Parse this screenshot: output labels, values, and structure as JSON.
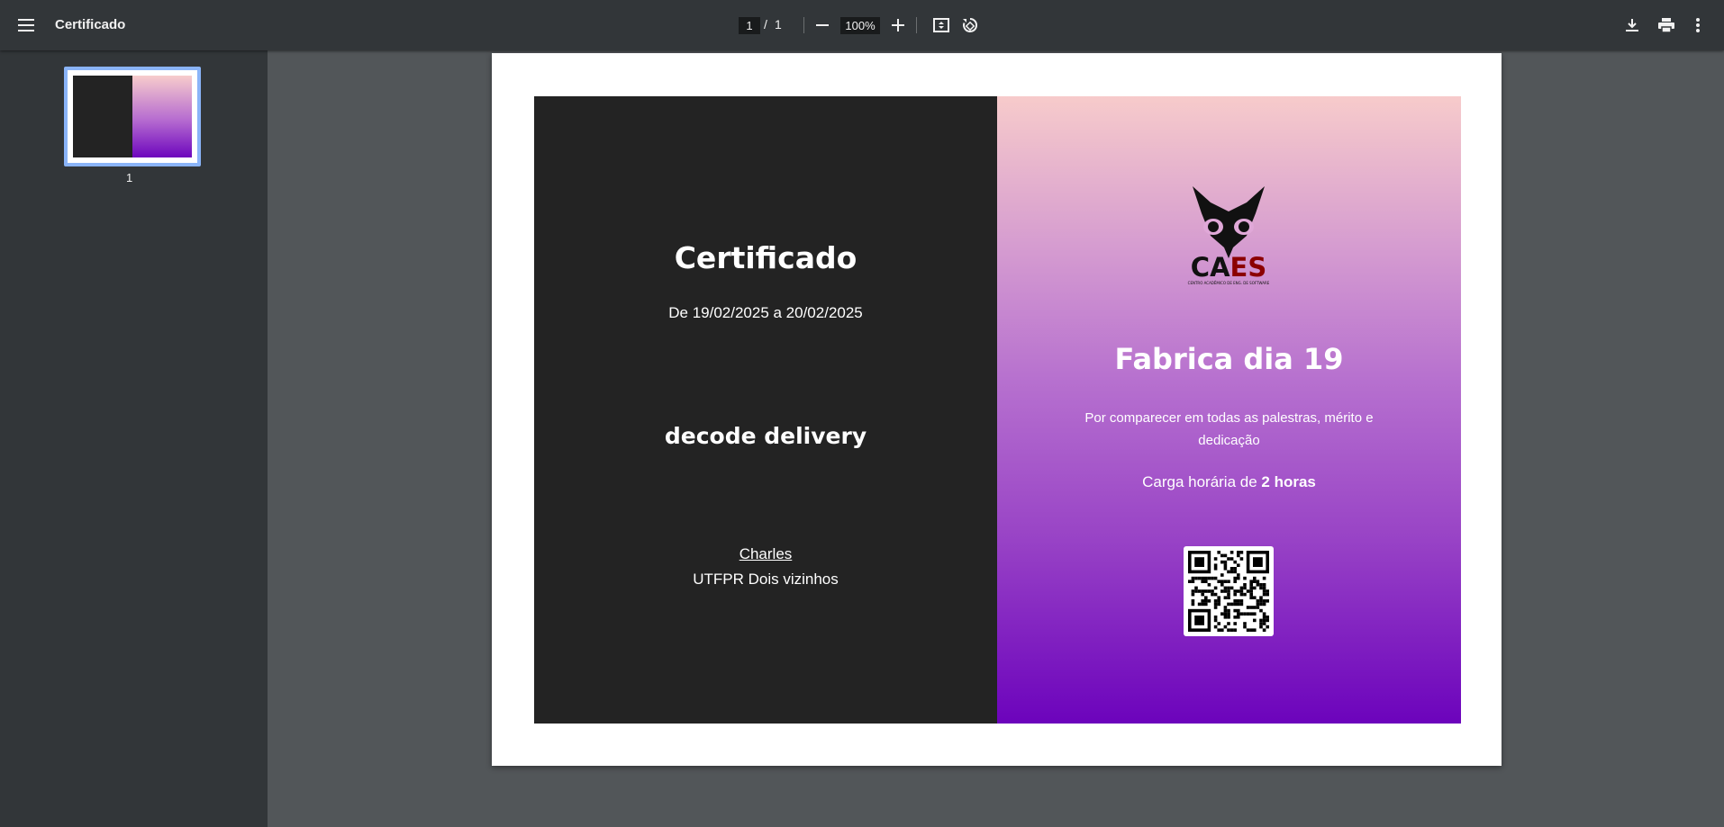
{
  "toolbar": {
    "title": "Certificado",
    "current_page": "1",
    "page_separator": "/",
    "total_pages": "1",
    "zoom": "100%"
  },
  "sidebar": {
    "thumbnail_number": "1"
  },
  "certificate": {
    "title": "Certificado",
    "dates": "De 19/02/2025 a 20/02/2025",
    "event": "decode delivery",
    "person": "Charles",
    "institution": "UTFPR Dois vizinhos",
    "logo_text": "CAES",
    "logo_subtext": "CENTRO ACADÊMICO DE ENG. DE SOFTWARE",
    "right_title": "Fabrica dia 19",
    "description": "Por comparecer em todas as palestras, mérito e dedicação",
    "hours_prefix": "Carga horária de",
    "hours_value": "2 horas"
  },
  "colors": {
    "toolbar_bg": "#323639",
    "viewer_bg": "#525659",
    "cert_left_bg": "#232323",
    "gradient_top": "#f7cbcb",
    "gradient_bottom": "#6c03bc",
    "thumb_border": "#8ab4f8",
    "logo_red": "#8b0000"
  },
  "icons": [
    "menu-icon",
    "zoom-out-icon",
    "zoom-in-icon",
    "fit-page-icon",
    "rotate-icon",
    "download-icon",
    "print-icon",
    "more-vert-icon"
  ]
}
